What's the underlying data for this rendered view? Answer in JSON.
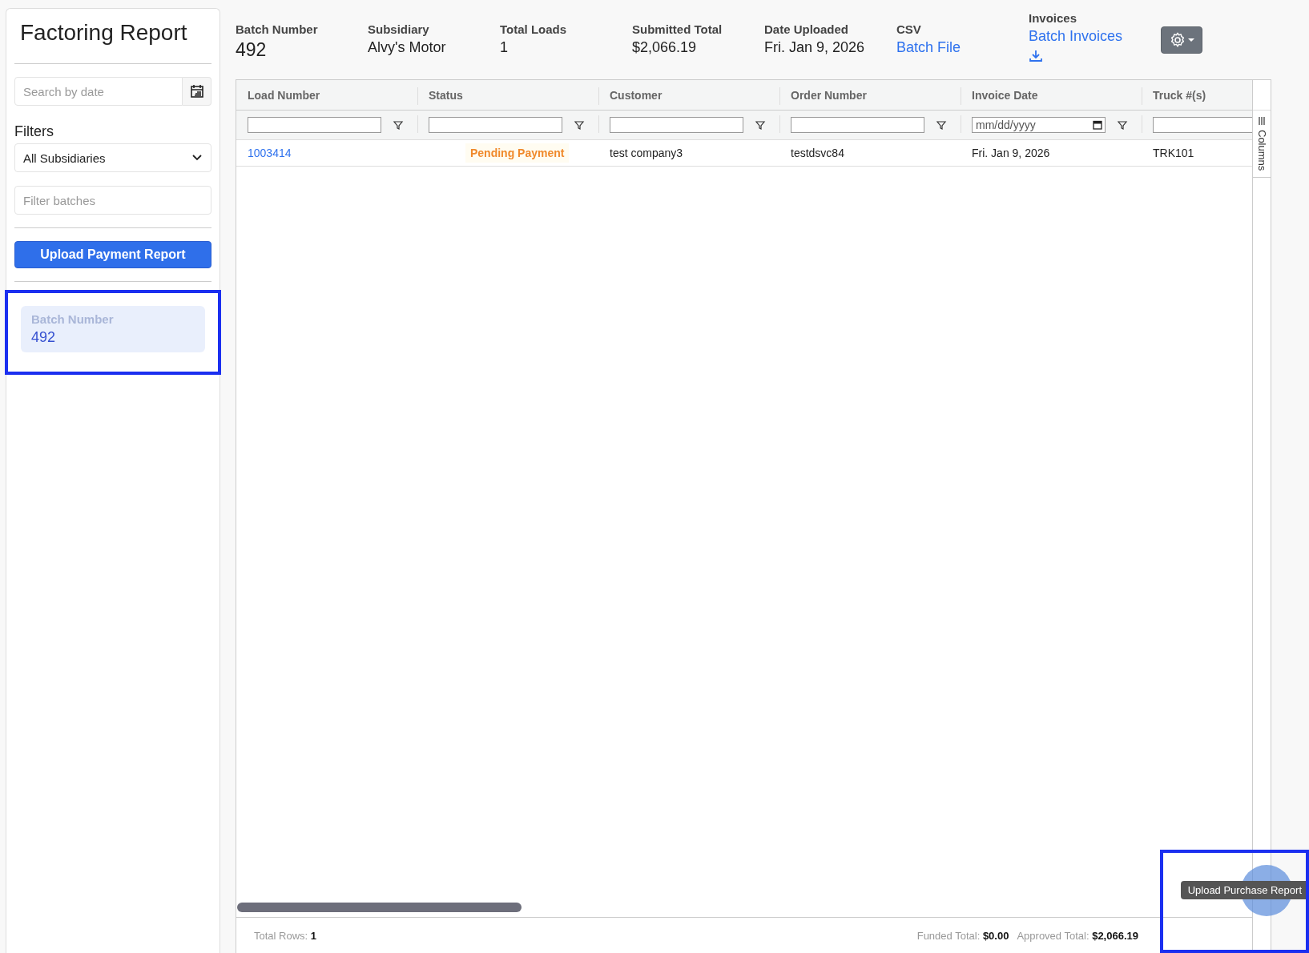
{
  "sidebar": {
    "title": "Factoring Report",
    "date_search": {
      "placeholder": "Search by date"
    },
    "filters_label": "Filters",
    "subsidiary_select": {
      "value": "All Subsidiaries"
    },
    "batch_filter": {
      "placeholder": "Filter batches"
    },
    "upload_button": "Upload Payment Report",
    "batches": [
      {
        "label": "Batch Number",
        "number": "492",
        "selected": true
      }
    ]
  },
  "summary": [
    {
      "label": "Batch Number",
      "value": "492",
      "kind": "text"
    },
    {
      "label": "Subsidiary",
      "value": "Alvy's Motor",
      "kind": "text"
    },
    {
      "label": "Total Loads",
      "value": "1",
      "kind": "text"
    },
    {
      "label": "Submitted Total",
      "value": "$2,066.19",
      "kind": "text"
    },
    {
      "label": "Date Uploaded",
      "value": "Fri. Jan 9, 2026",
      "kind": "text"
    },
    {
      "label": "CSV",
      "value": "Batch File",
      "kind": "link"
    },
    {
      "label": "Invoices",
      "value": "Batch Invoices",
      "kind": "download"
    }
  ],
  "table": {
    "columns": [
      {
        "label": "Load Number",
        "kind": "text"
      },
      {
        "label": "Status",
        "kind": "text"
      },
      {
        "label": "Customer",
        "kind": "text"
      },
      {
        "label": "Order Number",
        "kind": "text"
      },
      {
        "label": "Invoice Date",
        "kind": "date",
        "placeholder": "mm/dd/yyyy"
      },
      {
        "label": "Truck #(s)",
        "kind": "text"
      }
    ],
    "rows": [
      {
        "cells": [
          {
            "text": "1003414",
            "kind": "link"
          },
          {
            "text": "Pending Payment",
            "kind": "status",
            "color": "#f0892b"
          },
          {
            "text": "test company3",
            "kind": "text"
          },
          {
            "text": "testdsvc84",
            "kind": "text"
          },
          {
            "text": "Fri. Jan 9, 2026",
            "kind": "text"
          },
          {
            "text": "TRK101",
            "kind": "text"
          }
        ]
      }
    ],
    "columns_panel": "Columns",
    "footer": {
      "total_rows_label": "Total Rows:",
      "total_rows": "1",
      "funded_label": "Funded Total:",
      "funded": "$0.00",
      "approved_label": "Approved Total:",
      "approved": "$2,066.19"
    }
  },
  "fab": {
    "tooltip": "Upload Purchase Report"
  }
}
